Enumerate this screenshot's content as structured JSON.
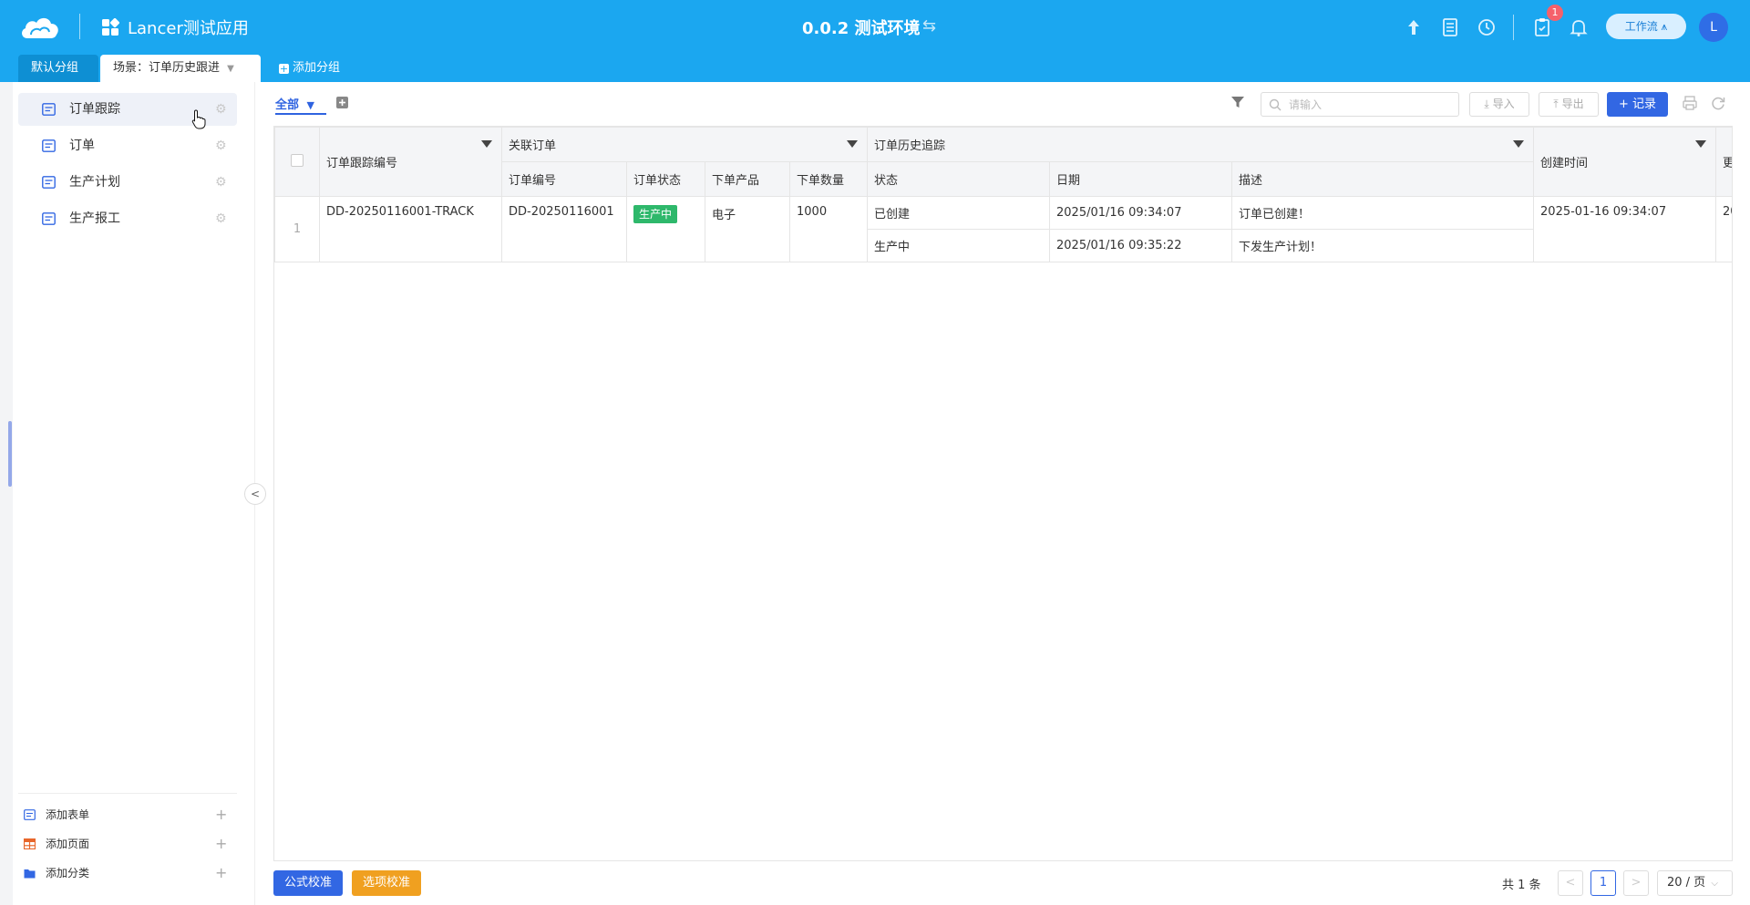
{
  "header": {
    "app_title": "Lancer测试应用",
    "env_title": "0.0.2 测试环境",
    "notification_count": "1",
    "workflow_label": "工作流",
    "avatar_initial": "L",
    "background_color": "#1ba7f0"
  },
  "group_tabs": {
    "default_label": "默认分组",
    "active_label": "场景：订单历史跟进",
    "add_label": "添加分组"
  },
  "sidebar": {
    "items": [
      {
        "label": "订单跟踪",
        "icon": "form-icon",
        "active": true
      },
      {
        "label": "订单",
        "icon": "form-icon",
        "active": false
      },
      {
        "label": "生产计划",
        "icon": "form-icon",
        "active": false
      },
      {
        "label": "生产报工",
        "icon": "form-icon",
        "active": false
      }
    ],
    "bottom": [
      {
        "label": "添加表单",
        "icon": "form-icon",
        "color": "#3267e3"
      },
      {
        "label": "添加页面",
        "icon": "page-icon",
        "color": "#e8672b"
      },
      {
        "label": "添加分类",
        "icon": "folder-icon",
        "color": "#3267e3"
      }
    ]
  },
  "toolbar": {
    "view_label": "全部",
    "search_placeholder": "请输入",
    "import_label": "导入",
    "export_label": "导出",
    "record_label": "+ 记录"
  },
  "table": {
    "headers": {
      "track_no": "订单跟踪编号",
      "related_order": "关联订单",
      "order_no": "订单编号",
      "order_status": "订单状态",
      "product": "下单产品",
      "quantity": "下单数量",
      "history": "订单历史追踪",
      "h_status": "状态",
      "h_date": "日期",
      "h_desc": "描述",
      "created_at": "创建时间",
      "more": "更"
    },
    "rows": [
      {
        "index": "1",
        "track_no": "DD-20250116001-TRACK",
        "order_no": "DD-20250116001",
        "order_status": "生产中",
        "product": "电子",
        "quantity": "1000",
        "created_at": "2025-01-16 09:34:07",
        "more": "20",
        "history": [
          {
            "status": "已创建",
            "date": "2025/01/16 09:34:07",
            "desc": "订单已创建！"
          },
          {
            "status": "生产中",
            "date": "2025/01/16 09:35:22",
            "desc": "下发生产计划！"
          }
        ]
      }
    ],
    "status_color": "#2eb86b"
  },
  "footer": {
    "formula_check": "公式校准",
    "option_check": "选项校准",
    "total": "共 1 条",
    "current_page": "1",
    "page_size": "20 / 页",
    "formula_color": "#3267e3",
    "option_color": "#f0a020"
  }
}
